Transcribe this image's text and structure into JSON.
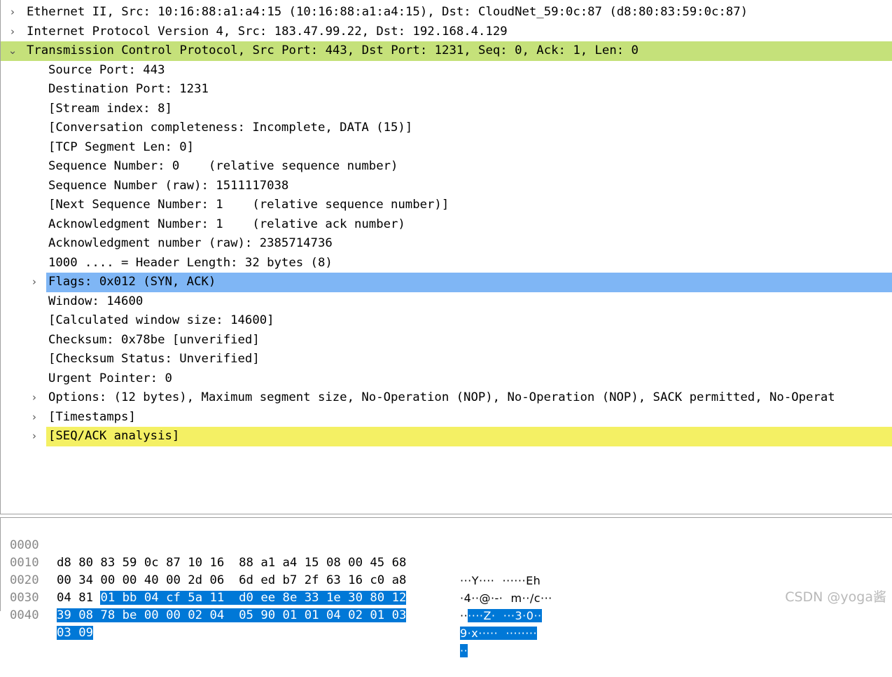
{
  "tree": {
    "top_rows": [
      {
        "label": "Ethernet II, Src: 10:16:88:a1:a4:15 (10:16:88:a1:a4:15), Dst: CloudNet_59:0c:87 (d8:80:83:59:0c:87)",
        "expander": ">"
      },
      {
        "label": "Internet Protocol Version 4, Src: 183.47.99.22, Dst: 192.168.4.129",
        "expander": ">"
      },
      {
        "label": "Transmission Control Protocol, Src Port: 443, Dst Port: 1231, Seq: 0, Ack: 1, Len: 0",
        "expander": "v"
      }
    ],
    "tcp_fields": [
      "Source Port: 443",
      "Destination Port: 1231",
      "[Stream index: 8]",
      "[Conversation completeness: Incomplete, DATA (15)]",
      "[TCP Segment Len: 0]",
      "Sequence Number: 0    (relative sequence number)",
      "Sequence Number (raw): 1511117038",
      "[Next Sequence Number: 1    (relative sequence number)]",
      "Acknowledgment Number: 1    (relative ack number)",
      "Acknowledgment number (raw): 2385714736",
      "1000 .... = Header Length: 32 bytes (8)",
      "Flags: 0x012 (SYN, ACK)",
      "Window: 14600",
      "[Calculated window size: 14600]",
      "Checksum: 0x78be [unverified]",
      "[Checksum Status: Unverified]",
      "Urgent Pointer: 0",
      "Options: (12 bytes), Maximum segment size, No-Operation (NOP), No-Operation (NOP), SACK permitted, No-Operat",
      "[Timestamps]",
      "[SEQ/ACK analysis]"
    ],
    "expander_collapsed": ">",
    "highlight_colors": {
      "protocol": "#c5e17a",
      "selected": "#7fb6f5",
      "analysis": "#f4f064"
    }
  },
  "hex": {
    "rows": [
      {
        "offset": "0000",
        "bytes_a": "d8 80 83 59 0c 87 10 16  88 a1 a4 15 08 00 45 68",
        "bytes_sel": "",
        "ascii_a": "···Y····  ······Eh",
        "ascii_sel": ""
      },
      {
        "offset": "0010",
        "bytes_a": "00 34 00 00 40 00 2d 06  6d ed b7 2f 63 16 c0 a8",
        "bytes_sel": "",
        "ascii_a": "·4··@·-·  m··/c···",
        "ascii_sel": ""
      },
      {
        "offset": "0020",
        "bytes_a": "04 81 ",
        "bytes_sel": "01 bb 04 cf 5a 11  d0 ee 8e 33 1e 30 80 12",
        "ascii_a": "··",
        "ascii_sel": "····Z·  ···3·0··"
      },
      {
        "offset": "0030",
        "bytes_a": "",
        "bytes_sel": "39 08 78 be 00 00 02 04  05 90 01 01 04 02 01 03",
        "ascii_a": "",
        "ascii_sel": "9·x·····  ········"
      },
      {
        "offset": "0040",
        "bytes_a": "",
        "bytes_sel": "03 09",
        "ascii_a": "",
        "ascii_sel": "··"
      }
    ],
    "selection_color": "#0078d7"
  },
  "watermark": "CSDN @yoga酱"
}
